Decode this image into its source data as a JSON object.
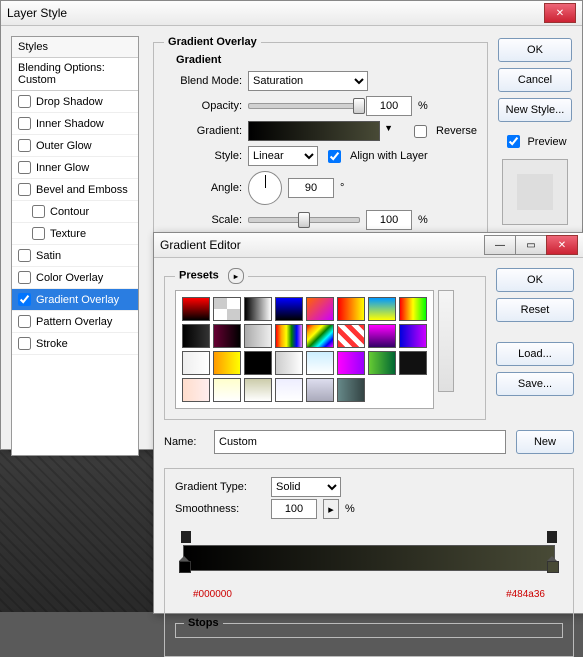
{
  "layerStyle": {
    "title": "Layer Style",
    "stylesHeader": "Styles",
    "blendingSub": "Blending Options: Custom",
    "items": [
      {
        "label": "Drop Shadow",
        "checked": false,
        "indent": false
      },
      {
        "label": "Inner Shadow",
        "checked": false,
        "indent": false
      },
      {
        "label": "Outer Glow",
        "checked": false,
        "indent": false
      },
      {
        "label": "Inner Glow",
        "checked": false,
        "indent": false
      },
      {
        "label": "Bevel and Emboss",
        "checked": false,
        "indent": false
      },
      {
        "label": "Contour",
        "checked": false,
        "indent": true
      },
      {
        "label": "Texture",
        "checked": false,
        "indent": true
      },
      {
        "label": "Satin",
        "checked": false,
        "indent": false
      },
      {
        "label": "Color Overlay",
        "checked": false,
        "indent": false
      },
      {
        "label": "Gradient Overlay",
        "checked": true,
        "indent": false,
        "selected": true
      },
      {
        "label": "Pattern Overlay",
        "checked": false,
        "indent": false
      },
      {
        "label": "Stroke",
        "checked": false,
        "indent": false
      }
    ],
    "ok": "OK",
    "cancel": "Cancel",
    "newStyle": "New Style...",
    "preview": "Preview"
  },
  "gradientOverlay": {
    "sectionTitle": "Gradient Overlay",
    "gradientGroup": "Gradient",
    "blendModeLabel": "Blend Mode:",
    "blendMode": "Saturation",
    "opacityLabel": "Opacity:",
    "opacity": "100",
    "pct": "%",
    "gradientLabel": "Gradient:",
    "reverse": "Reverse",
    "styleLabel": "Style:",
    "style": "Linear",
    "alignWithLayer": "Align with Layer",
    "angleLabel": "Angle:",
    "angle": "90",
    "deg": "°",
    "scaleLabel": "Scale:",
    "scale": "100"
  },
  "gradientEditor": {
    "title": "Gradient Editor",
    "presetsTitle": "Presets",
    "ok": "OK",
    "reset": "Reset",
    "load": "Load...",
    "save": "Save...",
    "nameLabel": "Name:",
    "name": "Custom",
    "new": "New",
    "gradientTypeLabel": "Gradient Type:",
    "gradientType": "Solid",
    "smoothnessLabel": "Smoothness:",
    "smoothness": "100",
    "pct": "%",
    "stopsTitle": "Stops",
    "hexLeft": "#000000",
    "hexRight": "#484a36",
    "presets": [
      "linear-gradient(to bottom,#f00,#000)",
      "repeating-conic-gradient(#fff 0 25%,#ccc 0 50%)",
      "linear-gradient(to right,#000,#fff)",
      "linear-gradient(to bottom,#00f,#000)",
      "linear-gradient(135deg,#f60,#c0f)",
      "linear-gradient(to right,#f00,#ff0)",
      "linear-gradient(to bottom,#09f,#ff0)",
      "linear-gradient(to right,#f00,#ff0,#0f0)",
      "linear-gradient(to right,#000,#333)",
      "linear-gradient(to right,#603,#000)",
      "linear-gradient(to right,#aaa,#eee)",
      "linear-gradient(to right,red,orange,yellow,green,blue,violet)",
      "linear-gradient(135deg,red,orange,yellow,green,cyan,blue,magenta)",
      "repeating-linear-gradient(45deg,#f33 0 5px,#fff 5px 10px)",
      "linear-gradient(to bottom,#f0f,#306)",
      "linear-gradient(to right,#00d,#c0f)",
      "linear-gradient(to right,#eee,#fff)",
      "linear-gradient(to right,#f90,#ff0)",
      "#000",
      "linear-gradient(to right,#ccc,#fff)",
      "linear-gradient(to bottom,#cef,#fff)",
      "linear-gradient(to right,#f0f,#90f)",
      "linear-gradient(to right,#6c3,#063)",
      "#111",
      "linear-gradient(to right,#fdc,#fee)",
      "linear-gradient(to bottom,#ffc,#fff)",
      "linear-gradient(to bottom,#cca,#fff)",
      "linear-gradient(to bottom,#eef,#fff)",
      "linear-gradient(to bottom,#dde,#aab)",
      "linear-gradient(to right,#688,#344)"
    ]
  }
}
